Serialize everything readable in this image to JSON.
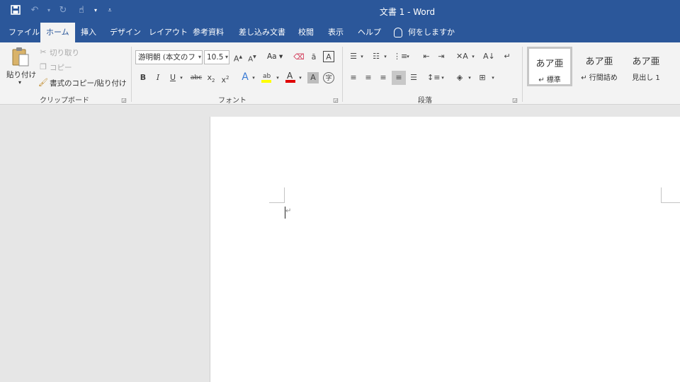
{
  "window": {
    "title": "文書 1  -  Word"
  },
  "qat": {
    "icons": [
      "save-icon",
      "undo-icon",
      "redo-icon",
      "touch-mode-icon",
      "customize-qat-icon"
    ]
  },
  "tabs": [
    "ファイル",
    "ホーム",
    "挿入",
    "デザイン",
    "レイアウト",
    "参考資料",
    "差し込み文書",
    "校閲",
    "表示",
    "ヘルプ"
  ],
  "active_tab": "ホーム",
  "tell_me": "何をしますか",
  "clipboard": {
    "paste": "貼り付け",
    "cut": "切り取り",
    "copy": "コピー",
    "format_painter": "書式のコピー/貼り付け",
    "label": "クリップボード"
  },
  "font": {
    "name": "游明朝 (本文のフ",
    "size": "10.5",
    "change_case": "Aa",
    "label": "フォント",
    "colors": {
      "highlight": "#ffff00",
      "font_color": "#e00000"
    }
  },
  "paragraph": {
    "label": "段落"
  },
  "styles": [
    {
      "sample": "あア亜",
      "name": "↵ 標準",
      "selected": true
    },
    {
      "sample": "あア亜",
      "name": "↵ 行間詰め",
      "selected": false
    },
    {
      "sample": "あア亜",
      "name": "見出し 1",
      "selected": false
    }
  ],
  "document": {
    "paragraph_mark": "↵"
  },
  "colors": {
    "brand": "#2b579a",
    "ribbon_bg": "#f3f3f3",
    "canvas_bg": "#e6e6e6"
  }
}
